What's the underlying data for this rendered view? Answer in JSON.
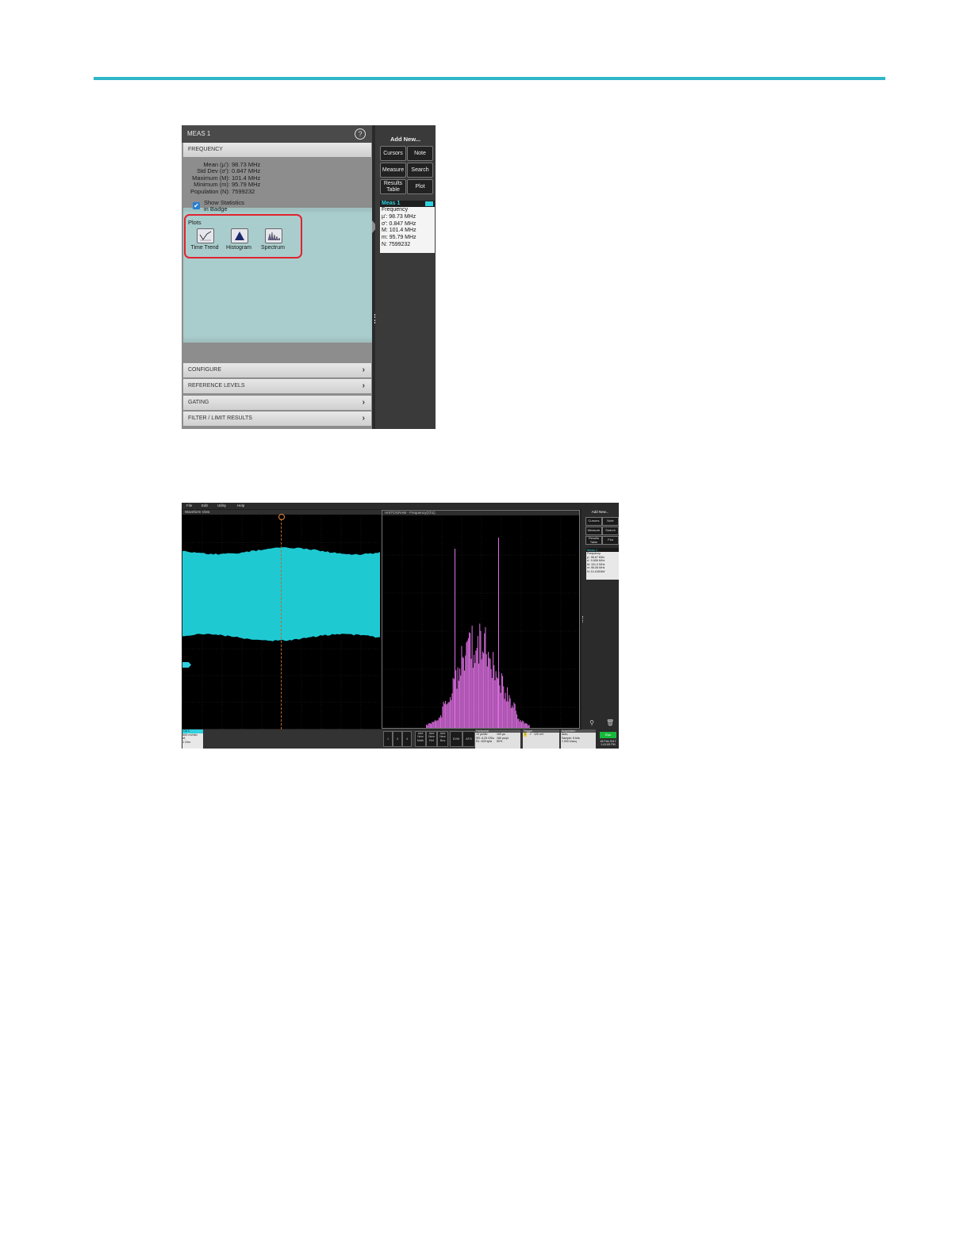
{
  "fig1": {
    "panel_title": "MEAS 1",
    "help_icon_label": "?",
    "sections": {
      "frequency": "FREQUENCY",
      "configure": "CONFIGURE",
      "reference_levels": "REFERENCE LEVELS",
      "gating": "GATING",
      "filter_limit": "FILTER / LIMIT RESULTS"
    },
    "stats": [
      {
        "label": "Mean (µ'):",
        "value": "98.73 MHz"
      },
      {
        "label": "Std Dev (σ'):",
        "value": "0.847 MHz"
      },
      {
        "label": "Maximum (M):",
        "value": "101.4 MHz"
      },
      {
        "label": "Minimum (m):",
        "value": "95.79 MHz"
      },
      {
        "label": "Population (N):",
        "value": "7599232"
      }
    ],
    "show_stats": {
      "line1": "Show Statistics",
      "line2": "in Badge",
      "checked": true
    },
    "plots": {
      "label": "Plots",
      "buttons": [
        {
          "label": "Time Trend",
          "icon": "time-trend-icon"
        },
        {
          "label": "Histogram",
          "icon": "histogram-icon"
        },
        {
          "label": "Spectrum",
          "icon": "spectrum-icon"
        }
      ]
    },
    "sidebar": {
      "add_new": "Add New...",
      "buttons": [
        "Cursors",
        "Note",
        "Measure",
        "Search",
        "Results Table",
        "Plot"
      ]
    },
    "badge": {
      "title": "Meas 1",
      "lines": [
        "Frequency",
        "µ': 98.73 MHz",
        "σ': 0.847 MHz",
        "M: 101.4 MHz",
        "m: 95.79 MHz",
        "N: 7599232"
      ]
    },
    "colors": {
      "accent": "#2fd0df",
      "highlight": "#e0232f"
    }
  },
  "fig2": {
    "menu": [
      "File",
      "Edit",
      "Utility",
      "Help"
    ],
    "waveform_title": "Waveform View",
    "histogram_title": "HISTOGRAM - Frequency(Ch1)",
    "sidebar": {
      "add_new": "Add New...",
      "buttons": [
        "Cursors",
        "Note",
        "Measure",
        "Search",
        "Results Table",
        "Plot"
      ]
    },
    "badge": {
      "title": "Meas 1",
      "lines": [
        "Frequency",
        "µ': 98.67 MHz",
        "σ': 0.806 MHz",
        "M: 101.0 MHz",
        "m: 96.08 MHz",
        "N: 14.11504M"
      ]
    },
    "channel": {
      "title": "Ch 1",
      "lines": [
        "500 mV/div",
        "IA",
        "1 Gns"
      ]
    },
    "bottom_buttons": [
      "1",
      "3",
      "4",
      "Add New Math",
      "Add New Ref",
      "Add New Bus",
      "DVM",
      "AFG"
    ],
    "horizontal": {
      "title": "Horizontal",
      "lines": [
        "10 µs/div",
        "SR: 6.25 GS/s",
        "RL: 625 kpts",
        "100 µs",
        "160 ps/pt",
        "50%"
      ]
    },
    "trigger": {
      "title": "Trigger",
      "lines": [
        "1",
        "↗",
        "120 mV"
      ]
    },
    "acquisition": {
      "title": "Acquisition",
      "lines": [
        "Auto,",
        "Sample: 8 bits",
        "1.000 k/acq",
        "Analyze"
      ]
    },
    "run_label": "Run",
    "date_lines": [
      "18 Feb 2017",
      "1:41:53 PM"
    ],
    "colors": {
      "waveform": "#1fc9d2",
      "histogram": "#e070e6"
    }
  }
}
